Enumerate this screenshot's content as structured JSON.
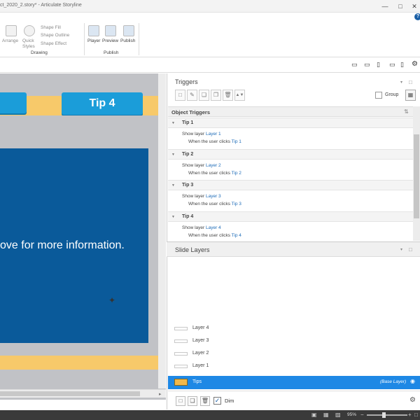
{
  "window": {
    "title": "ct_2020_2.story* - Articulate Storyline",
    "help_label": "?"
  },
  "ribbon": {
    "arrange_label": "Arrange",
    "quick_styles_label": "Quick\nStyles",
    "shape_fill_label": "Shape Fill",
    "shape_outline_label": "Shape Outline",
    "shape_effect_label": "Shape Effect",
    "drawing_group_label": "Drawing",
    "player_label": "Player",
    "preview_label": "Preview",
    "publish_label": "Publish",
    "publish_group_label": "Publish"
  },
  "stage": {
    "tip4_label": "Tip 4",
    "panel_text": "ove for more information."
  },
  "triggers": {
    "header": "Triggers",
    "group_label": "Group",
    "object_triggers_label": "Object Triggers",
    "items": [
      {
        "name": "Tip 1",
        "action": "Show layer ",
        "target": "Layer 1",
        "cond_pre": "When the user clicks ",
        "cond_target": "Tip 1"
      },
      {
        "name": "Tip 2",
        "action": "Show layer ",
        "target": "Layer 2",
        "cond_pre": "When the user clicks ",
        "cond_target": "Tip 2"
      },
      {
        "name": "Tip 3",
        "action": "Show layer ",
        "target": "Layer 3",
        "cond_pre": "When the user clicks ",
        "cond_target": "Tip 3"
      },
      {
        "name": "Tip 4",
        "action": "Show layer ",
        "target": "Layer 4",
        "cond_pre": "When the user clicks ",
        "cond_target": "Tip 4"
      }
    ]
  },
  "slide_layers": {
    "header": "Slide Layers",
    "layers": [
      "Layer 4",
      "Layer 3",
      "Layer 2",
      "Layer 1"
    ],
    "base_layer_name": "Tips",
    "base_layer_tag": "(Base Layer)",
    "dim_label": "Dim"
  },
  "status": {
    "zoom": "95%"
  },
  "colors": {
    "accent": "#1e88e5",
    "tip_button": "#1b9dd9",
    "slide_band": "#f7c96a",
    "panel": "#0a5a9a"
  }
}
